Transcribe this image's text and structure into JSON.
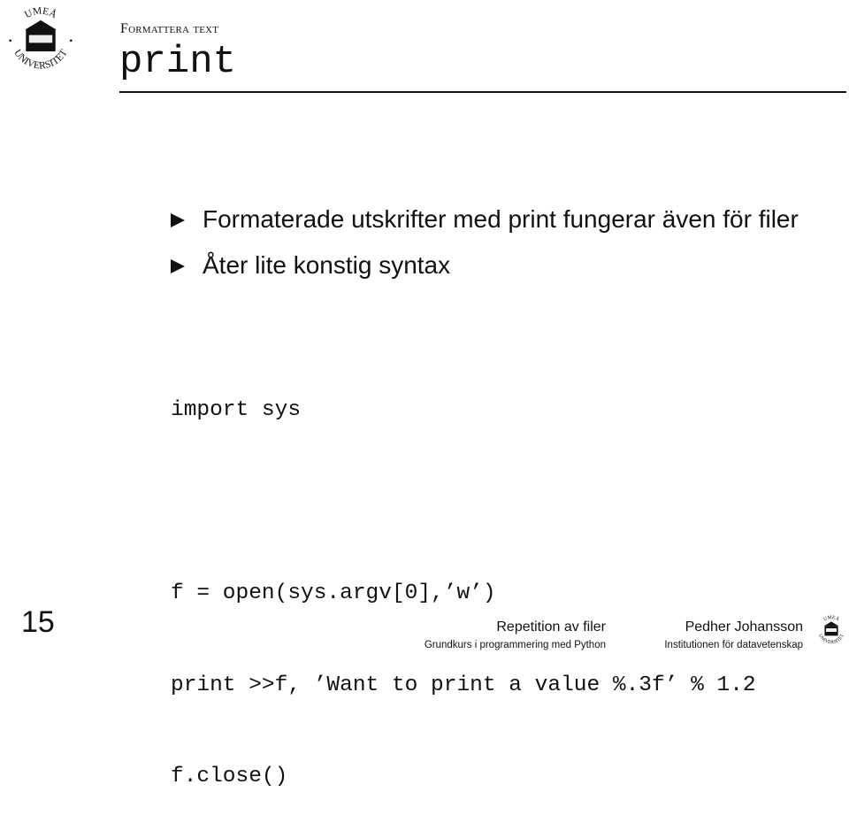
{
  "header": {
    "logo_text": "UMEÅ UNIVERSITET",
    "section": "Formattera text",
    "title": "print"
  },
  "bullets": [
    {
      "icon": "triangle-bullet-icon",
      "text": "Formaterade utskrifter med print fungerar även för filer"
    },
    {
      "icon": "triangle-bullet-icon",
      "text": "Åter lite konstig syntax"
    }
  ],
  "code": {
    "lines": [
      "import sys",
      "",
      "f = open(sys.argv[0],’w’)",
      "print >>f, ’Want to print a value %.3f’ % 1.2",
      "f.close()"
    ]
  },
  "footer": {
    "page_number": "15",
    "title": "Repetition av filer",
    "course": "Grundkurs i programmering med Python",
    "author": "Pedher Johansson",
    "institution": "Institutionen för datavetenskap",
    "logo_text": "UMEÅ UNIVERSITET"
  }
}
